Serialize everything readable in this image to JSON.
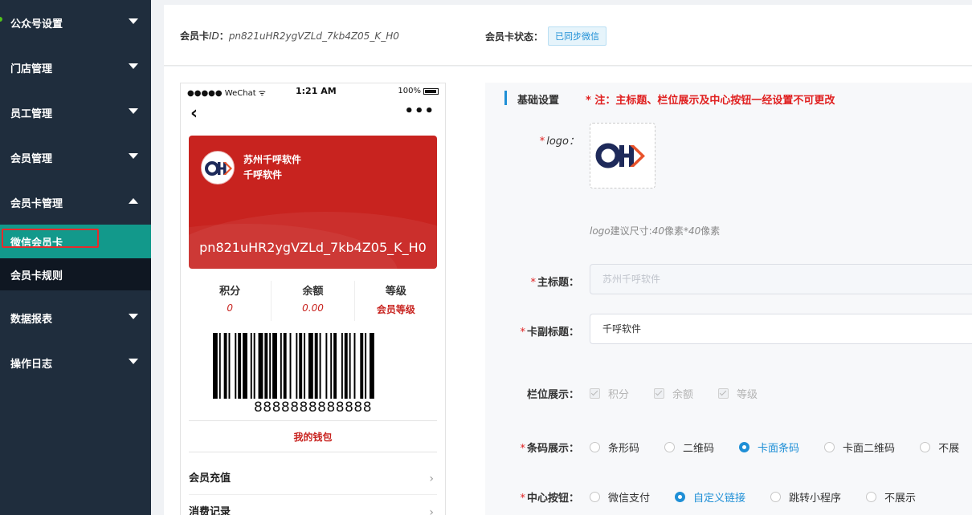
{
  "sidebar": {
    "items": [
      {
        "label": "公众号设置"
      },
      {
        "label": "门店管理"
      },
      {
        "label": "员工管理"
      },
      {
        "label": "会员管理"
      },
      {
        "label": "会员卡管理"
      }
    ],
    "sub_items": [
      {
        "label": "微信会员卡"
      },
      {
        "label": "会员卡规则"
      }
    ],
    "items_after": [
      {
        "label": "数据报表"
      },
      {
        "label": "操作日志"
      }
    ]
  },
  "header": {
    "card_id_label_a": "会员卡",
    "card_id_label_b": "ID",
    "card_id_sep": "：",
    "card_id_value": "pn821uHR2ygVZLd_7kb4Z05_K_H0",
    "status_label": "会员卡状态：",
    "status_badge": "已同步微信"
  },
  "phone": {
    "carrier": "●●●●● WeChat ᯤ",
    "time": "1:21 AM",
    "battery": "100%",
    "back": "‹",
    "more": "•••",
    "card_title": "苏州千呼软件",
    "card_subtitle": "千呼软件",
    "card_number": "pn821uHR2ygVZLd_7kb4Z05_K_H0",
    "stats": [
      {
        "label": "积分",
        "value": "0"
      },
      {
        "label": "余额",
        "value": "0.00"
      },
      {
        "label": "等级",
        "value": "会员等级"
      }
    ],
    "barcode_number": "8888888888888",
    "wallet": "我的钱包",
    "list": [
      {
        "label": "会员充值"
      },
      {
        "label": "消费记录"
      }
    ]
  },
  "form": {
    "section_title": "基础设置",
    "section_note": "*  注：主标题、栏位展示及中心按钮一经设置不可更改",
    "logo_label": "logo：",
    "logo_hint_a": "logo",
    "logo_hint_b": "建议尺寸:",
    "logo_hint_c": "40",
    "logo_hint_d": "像素*",
    "logo_hint_e": "40",
    "logo_hint_f": "像素",
    "title_label": "主标题：",
    "title_value": "苏州千呼软件",
    "subtitle_label": "卡副标题：",
    "subtitle_value": "千呼软件",
    "fields_label": "栏位展示：",
    "fields": [
      {
        "label": "积分"
      },
      {
        "label": "余额"
      },
      {
        "label": "等级"
      }
    ],
    "barcode_label": "条码展示：",
    "barcode_options": [
      {
        "label": "条形码"
      },
      {
        "label": "二维码"
      },
      {
        "label": "卡面条码"
      },
      {
        "label": "卡面二维码"
      },
      {
        "label": "不展"
      }
    ],
    "barcode_selected": "卡面条码",
    "center_label": "中心按钮：",
    "center_options": [
      {
        "label": "微信支付"
      },
      {
        "label": "自定义链接"
      },
      {
        "label": "跳转小程序"
      },
      {
        "label": "不展示"
      }
    ],
    "center_selected": "自定义链接",
    "required_mark": "*"
  },
  "colors": {
    "sidebar_bg": "#1f2d3d",
    "active_item": "#12998b",
    "card_red": "#c8231f",
    "accent_blue": "#1f8fd6",
    "note_red": "#e02020"
  }
}
